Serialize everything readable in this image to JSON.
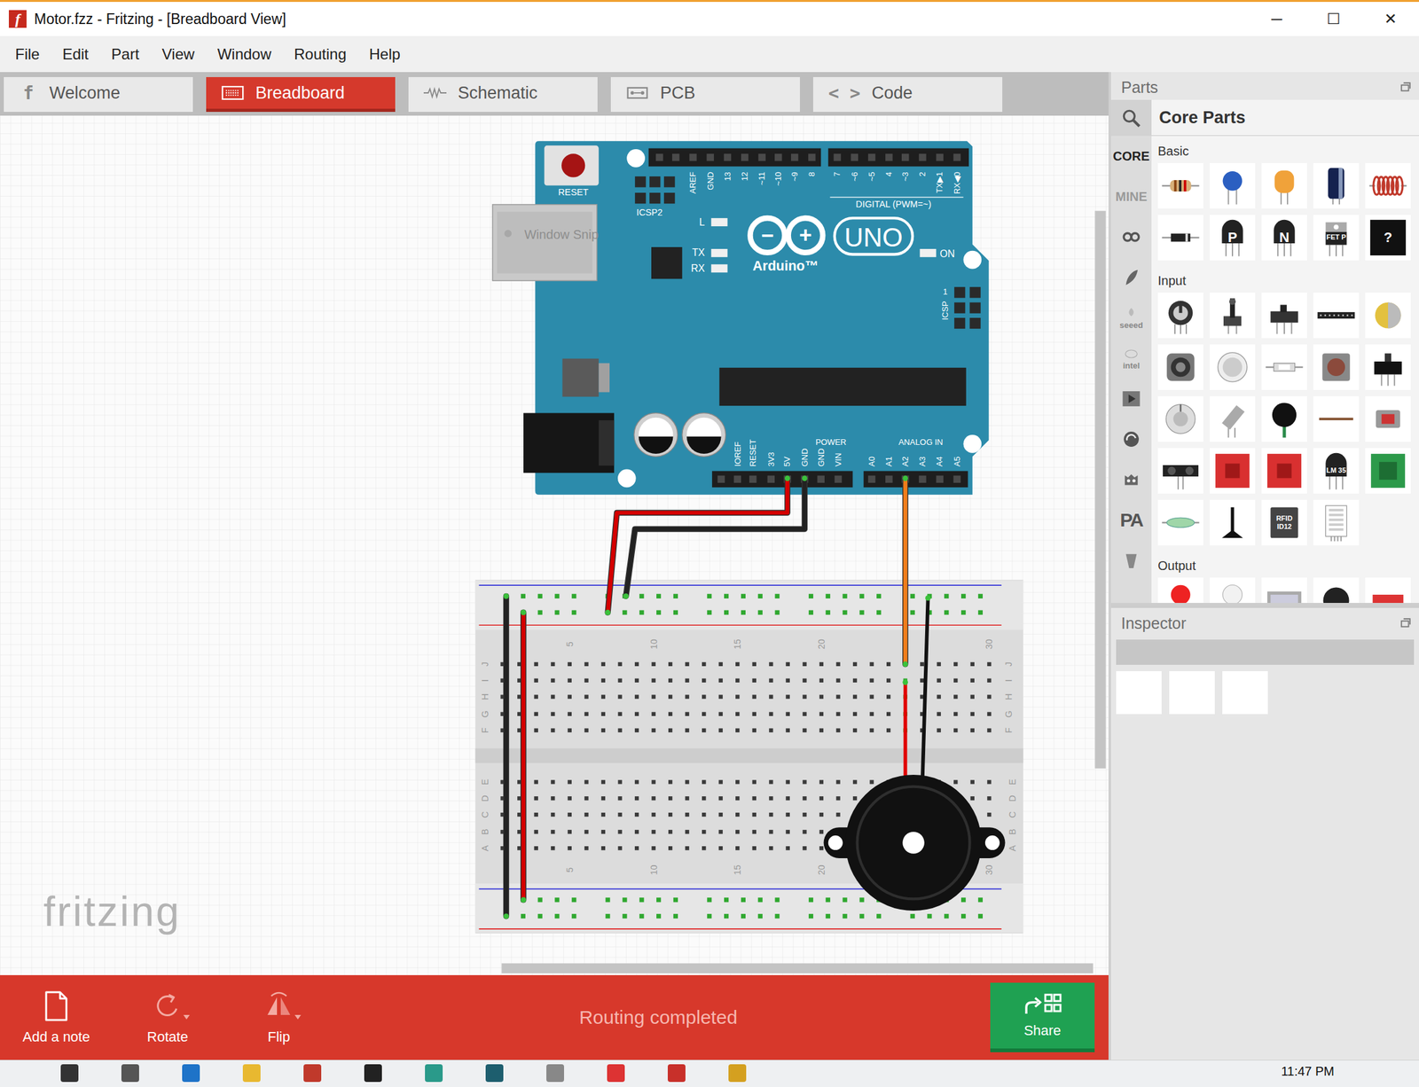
{
  "window": {
    "icon": "f",
    "title": "Motor.fzz - Fritzing - [Breadboard View]",
    "controls": [
      "─",
      "☐",
      "✕"
    ]
  },
  "menu": [
    "File",
    "Edit",
    "Part",
    "View",
    "Window",
    "Routing",
    "Help"
  ],
  "tabs": [
    {
      "label": "Welcome",
      "kind": "welcome",
      "icon_text": "f",
      "selected": false
    },
    {
      "label": "Breadboard",
      "kind": "breadboard",
      "selected": true
    },
    {
      "label": "Schematic",
      "kind": "schematic",
      "selected": false
    },
    {
      "label": "PCB",
      "kind": "pcb",
      "selected": false
    },
    {
      "label": "Code",
      "kind": "code",
      "icon_text": "< >",
      "selected": false
    }
  ],
  "canvas": {
    "arduino": {
      "reset_label": "RESET",
      "icsp2_label": "ICSP2",
      "digital_pins": [
        "AREF",
        "GND",
        "13",
        "12",
        "~11",
        "~10",
        "~9",
        "8",
        "7",
        "~6",
        "~5",
        "4",
        "~3",
        "2",
        "TX▶1",
        "RX◀0"
      ],
      "digital_title": "DIGITAL (PWM=~)",
      "led_labels": [
        "L",
        "TX",
        "RX"
      ],
      "logo_signs": [
        "−",
        "+"
      ],
      "model": "UNO",
      "brand": "Arduino™",
      "on_label": "ON",
      "icsp_label": "ICSP",
      "icsp_pin_label": "1",
      "power_pins": [
        "IOREF",
        "RESET",
        "3V3",
        "5V",
        "GND",
        "GND",
        "VIN"
      ],
      "power_title": "POWER",
      "analog_pins": [
        "A0",
        "A1",
        "A2",
        "A3",
        "A4",
        "A5"
      ],
      "analog_title": "ANALOG IN"
    },
    "breadboard": {
      "column_labels": [
        "5",
        "10",
        "15",
        "20",
        "30"
      ],
      "upper_rows": [
        "J",
        "I",
        "H",
        "G",
        "F"
      ],
      "lower_rows": [
        "E",
        "D",
        "C",
        "B",
        "A"
      ],
      "rails_connected": true,
      "connected_columns": [
        25
      ]
    },
    "wires": [
      {
        "color": "#d40000"
      },
      {
        "color": "#222222"
      },
      {
        "color": "#f07d1a"
      },
      {
        "color": "#222222"
      },
      {
        "color": "#d40000"
      }
    ],
    "buzzer_leads": [
      {
        "color": "#e00000"
      },
      {
        "color": "#111111"
      }
    ],
    "watermark": "fritzing",
    "overlay_text": "Window Snip"
  },
  "toolbar": {
    "buttons": [
      {
        "label": "Add a note",
        "kind": "note",
        "menu": false,
        "disabled": false
      },
      {
        "label": "Rotate",
        "kind": "rotate",
        "menu": true,
        "disabled": true
      },
      {
        "label": "Flip",
        "kind": "flip",
        "menu": true,
        "disabled": true
      }
    ],
    "status": "Routing completed",
    "share": "Share"
  },
  "parts": {
    "title": "Parts",
    "bin_title": "Core Parts",
    "bin_tabs": [
      {
        "kind": "text",
        "label": "CORE",
        "selected": true
      },
      {
        "kind": "text",
        "label": "MINE",
        "selected": false
      },
      {
        "kind": "arduino",
        "selected": false
      },
      {
        "kind": "feather",
        "selected": false
      },
      {
        "kind": "seeed",
        "label": "seeed",
        "selected": false
      },
      {
        "kind": "intel",
        "label": "intel",
        "selected": false
      },
      {
        "kind": "play",
        "selected": false
      },
      {
        "kind": "swirl",
        "selected": false
      },
      {
        "kind": "cat",
        "selected": false
      },
      {
        "kind": "pa",
        "label": "PA",
        "selected": false
      },
      {
        "kind": "more",
        "selected": false
      }
    ],
    "categories": [
      {
        "title": "Basic",
        "tiles": [
          {
            "kind": "resistor"
          },
          {
            "kind": "ceramic"
          },
          {
            "kind": "tantalum"
          },
          {
            "kind": "electrolytic"
          },
          {
            "kind": "inductor"
          },
          {
            "kind": "diode"
          },
          {
            "kind": "transistor",
            "label": "P"
          },
          {
            "kind": "transistor",
            "label": "N"
          },
          {
            "kind": "mosfet",
            "label": "FET P"
          },
          {
            "kind": "mystery",
            "label": "?"
          }
        ]
      },
      {
        "title": "Input",
        "tiles": [
          {
            "kind": "potentiometer"
          },
          {
            "kind": "trimmer"
          },
          {
            "kind": "slide-switch"
          },
          {
            "kind": "header-strip"
          },
          {
            "kind": "light-sensor"
          },
          {
            "kind": "rotary-pot"
          },
          {
            "kind": "dial"
          },
          {
            "kind": "fuse"
          },
          {
            "kind": "pushbutton"
          },
          {
            "kind": "toggle-switch"
          },
          {
            "kind": "knob"
          },
          {
            "kind": "tilt"
          },
          {
            "kind": "piezo"
          },
          {
            "kind": "wire"
          },
          {
            "kind": "ir-receiver"
          },
          {
            "kind": "ultrasonic"
          },
          {
            "kind": "red-board"
          },
          {
            "kind": "red-board"
          },
          {
            "kind": "transistor",
            "label": "LM 35"
          },
          {
            "kind": "green-board"
          },
          {
            "kind": "reed"
          },
          {
            "kind": "joystick"
          },
          {
            "kind": "rfid",
            "label": "RFID ID12"
          },
          {
            "kind": "dht"
          }
        ]
      },
      {
        "title": "Output",
        "tiles": [
          {
            "kind": "led-red"
          },
          {
            "kind": "led-white"
          },
          {
            "kind": "lcd"
          },
          {
            "kind": "buzzer"
          },
          {
            "kind": "led-strip"
          }
        ]
      }
    ]
  },
  "inspector": {
    "title": "Inspector"
  },
  "taskbar": {
    "time": "11:47 PM"
  }
}
